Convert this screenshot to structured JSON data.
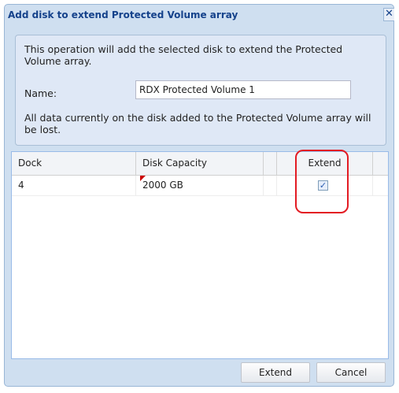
{
  "dialog": {
    "title": "Add disk to extend Protected Volume array",
    "close_glyph": "✕",
    "message": "This operation will add the selected disk to extend the Protected Volume array.",
    "name_label": "Name:",
    "name_value": "RDX Protected Volume 1",
    "warning": "All data currently on the disk added to the Protected Volume array will be lost."
  },
  "grid": {
    "columns": [
      "Dock",
      "Disk Capacity",
      "Extend"
    ],
    "rows": [
      {
        "dock": "4",
        "capacity": "2000 GB",
        "extend_checked": true,
        "extend_glyph": "✓"
      }
    ]
  },
  "buttons": {
    "extend": "Extend",
    "cancel": "Cancel"
  },
  "colors": {
    "title": "#15428b",
    "highlight": "#e31b23",
    "dialog_bg": "#cfdff0"
  }
}
